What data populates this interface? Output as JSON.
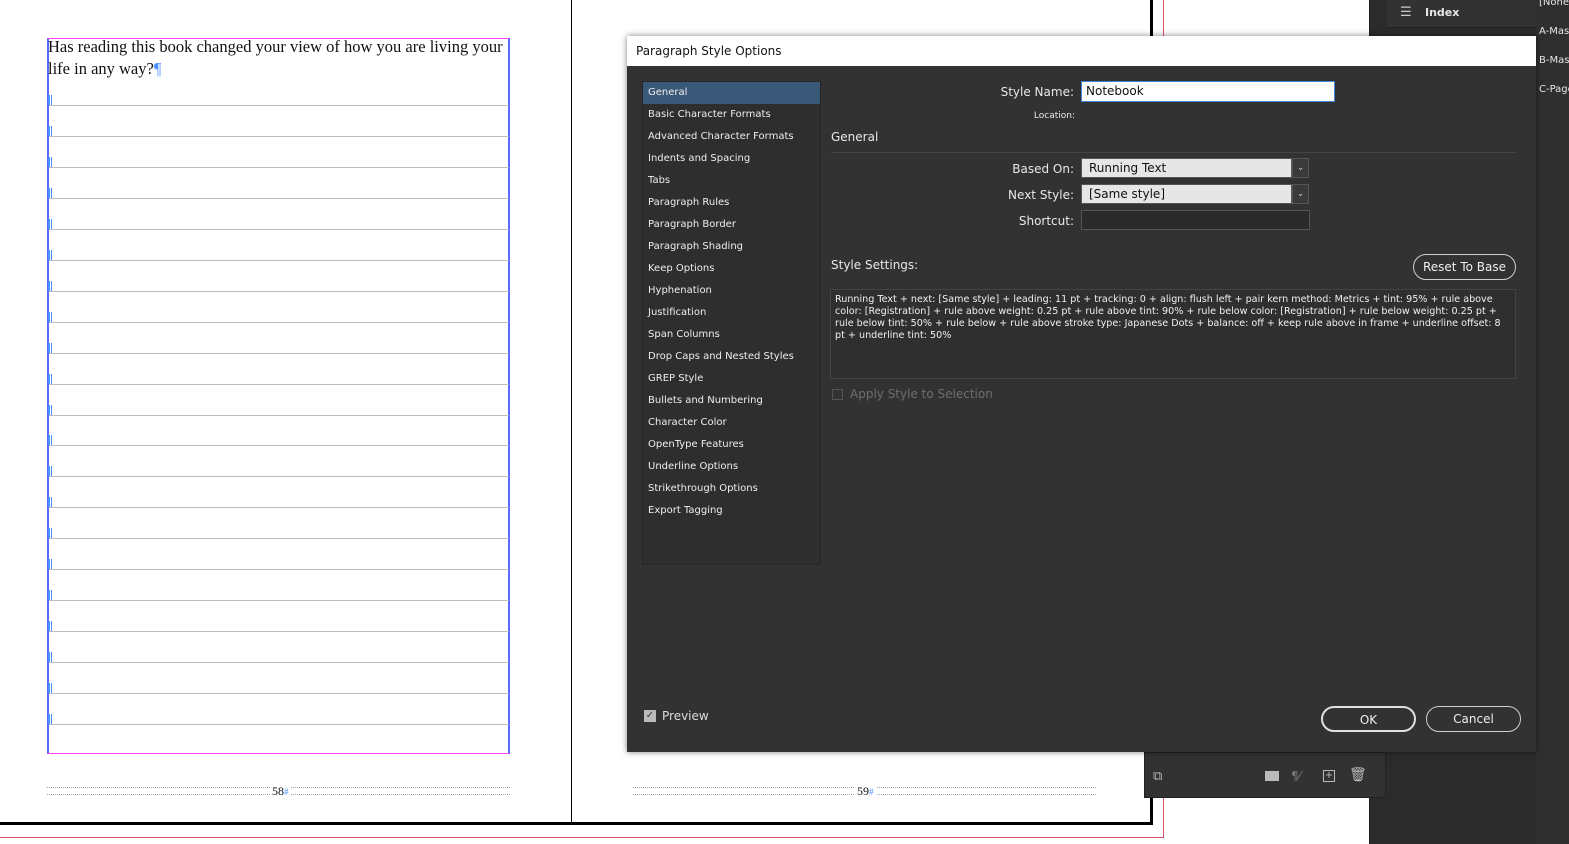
{
  "document": {
    "question_text": "Has reading this book changed your view of how you are living your life in any way?",
    "pilcrow": "¶",
    "folio_left": "58",
    "folio_right": "59",
    "folio_marker": "#"
  },
  "pages_panel": {
    "index_label": "Index",
    "masters": [
      "[None]",
      "A-Master",
      "B-Master",
      "C-Page"
    ]
  },
  "dialog": {
    "title": "Paragraph Style Options",
    "categories": [
      "General",
      "Basic Character Formats",
      "Advanced Character Formats",
      "Indents and Spacing",
      "Tabs",
      "Paragraph Rules",
      "Paragraph Border",
      "Paragraph Shading",
      "Keep Options",
      "Hyphenation",
      "Justification",
      "Span Columns",
      "Drop Caps and Nested Styles",
      "GREP Style",
      "Bullets and Numbering",
      "Character Color",
      "OpenType Features",
      "Underline Options",
      "Strikethrough Options",
      "Export Tagging"
    ],
    "selected_category": "General",
    "style_name_label": "Style Name:",
    "style_name_value": "Notebook",
    "location_label": "Location:",
    "section_title": "General",
    "based_on_label": "Based On:",
    "based_on_value": "Running Text",
    "next_style_label": "Next Style:",
    "next_style_value": "[Same style]",
    "shortcut_label": "Shortcut:",
    "shortcut_value": "",
    "style_settings_label": "Style Settings:",
    "reset_button": "Reset To Base",
    "style_settings_text": "Running Text + next: [Same style] + leading: 11 pt + tracking: 0 + align: flush left + pair kern method: Metrics + tint: 95% + rule above color: [Registration] + rule above weight: 0.25 pt + rule above tint: 90% + rule below color: [Registration] + rule below weight: 0.25 pt + rule below tint: 50% + rule below + rule above stroke type: Japanese Dots + balance: off + keep rule above in frame + underline offset: 8 pt + underline tint: 50%",
    "apply_style_label": "Apply Style to Selection",
    "apply_style_checked": false,
    "preview_label": "Preview",
    "preview_checked": true,
    "ok_button": "OK",
    "cancel_button": "Cancel"
  },
  "colors": {
    "dialog_bg": "#323232",
    "selection": "#3a5878",
    "frame_edge": "#ff3df5",
    "text_frame": "#5a6bff"
  }
}
